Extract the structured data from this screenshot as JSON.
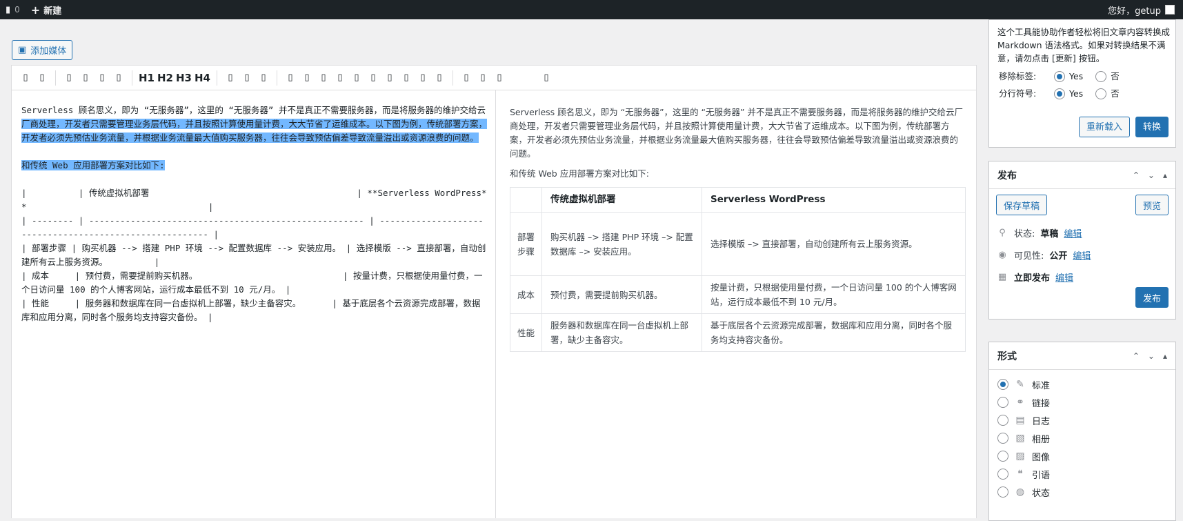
{
  "adminbar": {
    "comments_count": "0",
    "new_label": "新建",
    "howdy": "您好，getup"
  },
  "editor": {
    "add_media_label": "添加媒体",
    "toolbar": {
      "headings": [
        "H1",
        "H2",
        "H3",
        "H4"
      ]
    },
    "source": {
      "para1_start": "Serverless 顾名思义，即为 “无服务器”，这里的 “无服务器” 并不是真正不需要服务器，而是将服务器的维护交给云",
      "para1_highlight": "厂商处理，开发者只需要管理业务层代码，并且按照计算使用量计费，大大节省了运维成本。以下图为例，传统部署方案，开发者必须先预估业务流量，并根据业务流量最大值购买服务器，往往会导致预估偏差导致流量溢出或资源浪费的问题。\n\n和传统 Web 应用部署方案对比如下:",
      "table_md": "|          | 传统虚拟机部署                                        | **Serverless WordPress**                                   |\n| -------- | ----------------------------------------------------- | -------------------------------------------------------- |\n| 部署步骤 | 购买机器 --> 搭建 PHP 环境 --> 配置数据库 --> 安装应用。 | 选择模版 --> 直接部署，自动创建所有云上服务资源。         |\n| 成本     | 预付费，需要提前购买机器。                            | 按量计费，只根据使用量付费，一个日访问量 100 的个人博客网站，运行成本最低不到 10 元/月。 |\n| 性能     | 服务器和数据库在同一台虚拟机上部署，缺少主备容灾。      | 基于底层各个云资源完成部署，数据库和应用分离，同时各个服务均支持容灾备份。 |"
    },
    "preview": {
      "para1": "Serverless 顾名思义，即为 “无服务器”，这里的 “无服务器” 并不是真正不需要服务器，而是将服务器的维护交给云厂商处理，开发者只需要管理业务层代码，并且按照计算使用量计费，大大节省了运维成本。以下图为例，传统部署方案，开发者必须先预估业务流量，并根据业务流量最大值购买服务器，往往会导致预估偏差导致流量溢出或资源浪费的问题。",
      "para2": "和传统 Web 应用部署方案对比如下:",
      "table": {
        "headers": [
          "",
          "传统虚拟机部署",
          "Serverless WordPress"
        ],
        "rows": [
          [
            "部署步骤",
            "购买机器 –> 搭建 PHP 环境 –> 配置数据库 –> 安装应用。",
            "选择模版 –> 直接部署，自动创建所有云上服务资源。"
          ],
          [
            "成本",
            "预付费，需要提前购买机器。",
            "按量计费，只根据使用量付费，一个日访问量 100 的个人博客网站，运行成本最低不到 10 元/月。"
          ],
          [
            "性能",
            "服务器和数据库在同一台虚拟机上部署，缺少主备容灾。",
            "基于底层各个云资源完成部署，数据库和应用分离，同时各个服务均支持容灾备份。"
          ]
        ]
      }
    }
  },
  "sidebar": {
    "markdown_box": {
      "description": "这个工具能协助作者轻松将旧文章内容转换成 Markdown 语法格式。如果对转换结果不满意，请勿点击 [更新] 按钮。",
      "remove_tags_label": "移除标签:",
      "line_break_label": "分行符号:",
      "yes": "Yes",
      "no": "否",
      "reload_label": "重新载入",
      "convert_label": "转换"
    },
    "publish_box": {
      "title": "发布",
      "save_draft": "保存草稿",
      "preview": "预览",
      "status_label": "状态:",
      "status_value": "草稿",
      "visibility_label": "可见性:",
      "visibility_value": "公开",
      "schedule_label": "立即发布",
      "edit": "编辑",
      "publish": "发布"
    },
    "format_box": {
      "title": "形式",
      "options": [
        "标准",
        "链接",
        "日志",
        "相册",
        "图像",
        "引语",
        "状态"
      ]
    }
  }
}
